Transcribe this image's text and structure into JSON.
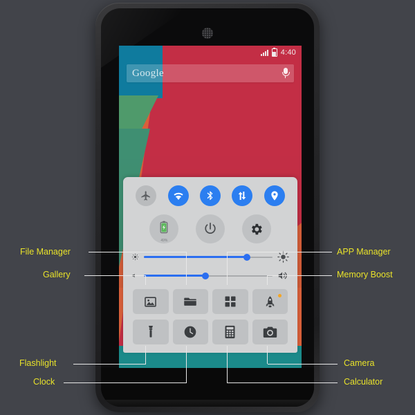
{
  "phone": {
    "status_bar": {
      "signal_icon": "signal-bars-icon",
      "battery_icon": "battery-icon",
      "time": "4:40"
    },
    "search_widget": {
      "brand_text": "Google",
      "mic_icon": "microphone-icon"
    },
    "wallpaper": {
      "colors": {
        "orange": "#d9603a",
        "red": "#c32e45",
        "blue": "#0f7b9e",
        "green": "#4f9a6b",
        "teal": "#1b8a8a"
      }
    }
  },
  "control_panel": {
    "toggles": [
      {
        "name": "airplane-mode",
        "icon": "airplane-icon",
        "state": "off"
      },
      {
        "name": "wifi",
        "icon": "wifi-icon",
        "state": "on"
      },
      {
        "name": "bluetooth",
        "icon": "bluetooth-icon",
        "state": "on"
      },
      {
        "name": "data-sync",
        "icon": "data-sync-icon",
        "state": "on"
      },
      {
        "name": "location",
        "icon": "location-pin-icon",
        "state": "on"
      }
    ],
    "big_buttons": [
      {
        "name": "battery",
        "icon": "battery-charging-icon",
        "value": "49%"
      },
      {
        "name": "power",
        "icon": "power-icon"
      },
      {
        "name": "settings",
        "icon": "gear-icon"
      }
    ],
    "sliders": [
      {
        "name": "brightness",
        "left_icon": "brightness-low-icon",
        "right_icon": "brightness-high-icon",
        "value": 80
      },
      {
        "name": "volume",
        "left_icon": "volume-low-icon",
        "right_icon": "volume-high-icon",
        "value": 48
      }
    ],
    "apps": [
      {
        "name": "gallery",
        "icon": "image-icon"
      },
      {
        "name": "file-manager",
        "icon": "folder-icon"
      },
      {
        "name": "app-manager",
        "icon": "grid-squares-icon"
      },
      {
        "name": "memory-boost",
        "icon": "rocket-icon",
        "badge": true
      },
      {
        "name": "flashlight",
        "icon": "flashlight-icon"
      },
      {
        "name": "clock",
        "icon": "clock-icon"
      },
      {
        "name": "calculator",
        "icon": "calculator-icon"
      },
      {
        "name": "camera",
        "icon": "camera-icon"
      }
    ]
  },
  "annotations": {
    "accent_color": "#e8e22a",
    "leader_color": "#e8e8e8",
    "labels": {
      "file_manager": "File Manager",
      "gallery": "Gallery",
      "app_manager": "APP Manager",
      "memory_boost": "Memory Boost",
      "flashlight": "Flashlight",
      "clock": "Clock",
      "camera": "Camera",
      "calculator": "Calculator"
    }
  }
}
